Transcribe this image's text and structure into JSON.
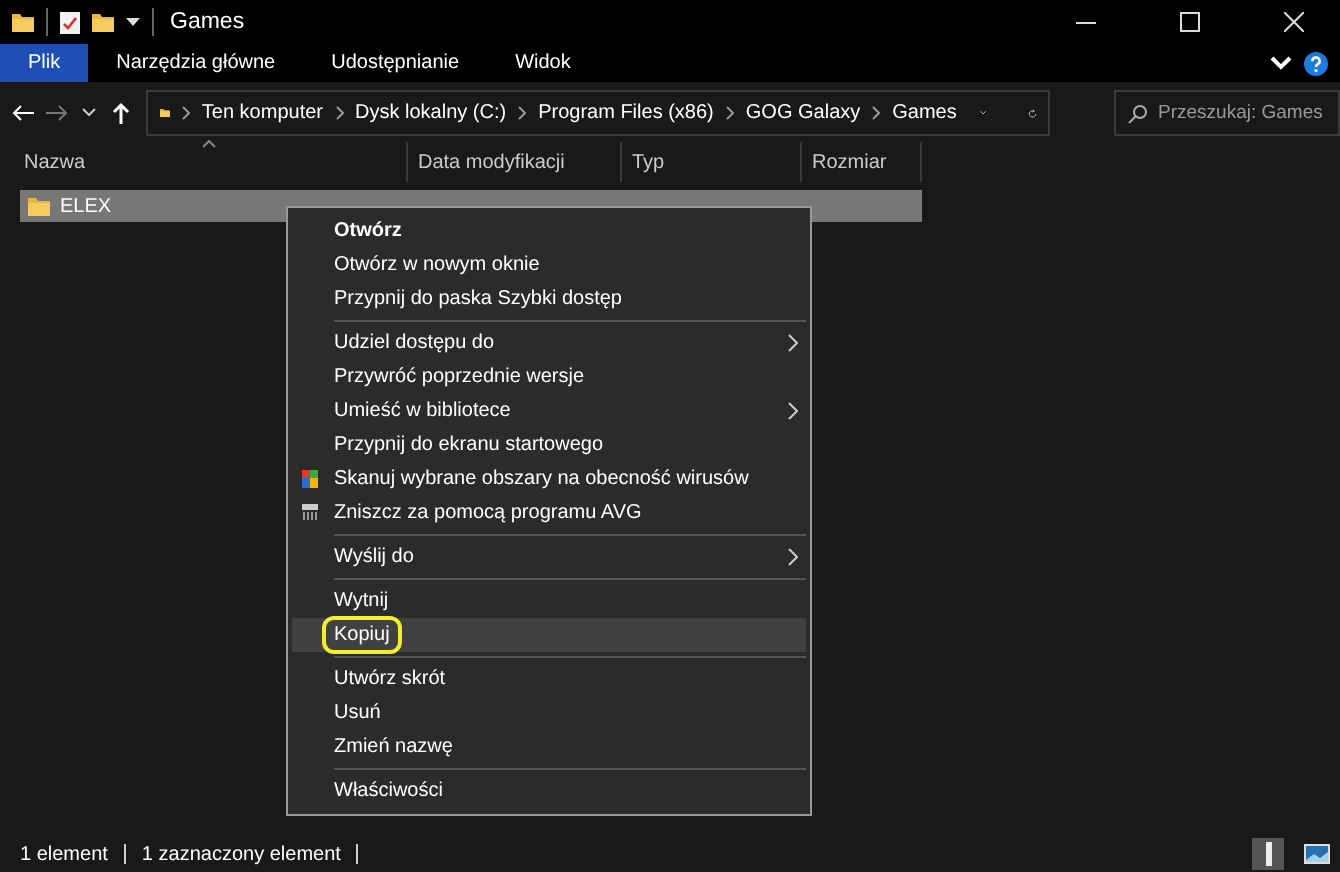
{
  "window": {
    "title": "Games"
  },
  "ribbon_tabs": [
    {
      "label": "Plik",
      "selected": true
    },
    {
      "label": "Narzędzia główne",
      "selected": false
    },
    {
      "label": "Udostępnianie",
      "selected": false
    },
    {
      "label": "Widok",
      "selected": false
    }
  ],
  "breadcrumb": [
    "Ten komputer",
    "Dysk lokalny (C:)",
    "Program Files (x86)",
    "GOG Galaxy",
    "Games"
  ],
  "search": {
    "placeholder": "Przeszukaj: Games"
  },
  "columns": [
    "Nazwa",
    "Data modyfikacji",
    "Typ",
    "Rozmiar"
  ],
  "files": [
    {
      "name": "ELEX",
      "selected": true
    }
  ],
  "context_menu": [
    {
      "kind": "item",
      "label": "Otwórz",
      "bold": true,
      "submenu": false,
      "selected": false,
      "outlined": false
    },
    {
      "kind": "item",
      "label": "Otwórz w nowym oknie",
      "bold": false,
      "submenu": false,
      "selected": false,
      "outlined": false
    },
    {
      "kind": "item",
      "label": "Przypnij do paska Szybki dostęp",
      "bold": false,
      "submenu": false,
      "selected": false,
      "outlined": false
    },
    {
      "kind": "separator"
    },
    {
      "kind": "item",
      "label": "Udziel dostępu do",
      "bold": false,
      "submenu": true,
      "selected": false,
      "outlined": false
    },
    {
      "kind": "item",
      "label": "Przywróć poprzednie wersje",
      "bold": false,
      "submenu": false,
      "selected": false,
      "outlined": false
    },
    {
      "kind": "item",
      "label": "Umieść w bibliotece",
      "bold": false,
      "submenu": true,
      "selected": false,
      "outlined": false
    },
    {
      "kind": "item",
      "label": "Przypnij do ekranu startowego",
      "bold": false,
      "submenu": false,
      "selected": false,
      "outlined": false
    },
    {
      "kind": "scan",
      "label": "Skanuj wybrane obszary na obecność wirusów",
      "bold": false,
      "submenu": false,
      "selected": false,
      "outlined": false
    },
    {
      "kind": "shred",
      "label": "Zniszcz za pomocą programu AVG",
      "bold": false,
      "submenu": false,
      "selected": false,
      "outlined": false
    },
    {
      "kind": "separator"
    },
    {
      "kind": "item",
      "label": "Wyślij do",
      "bold": false,
      "submenu": true,
      "selected": false,
      "outlined": false
    },
    {
      "kind": "separator"
    },
    {
      "kind": "item",
      "label": "Wytnij",
      "bold": false,
      "submenu": false,
      "selected": false,
      "outlined": false
    },
    {
      "kind": "item",
      "label": "Kopiuj",
      "bold": false,
      "submenu": false,
      "selected": true,
      "outlined": true
    },
    {
      "kind": "separator"
    },
    {
      "kind": "item",
      "label": "Utwórz skrót",
      "bold": false,
      "submenu": false,
      "selected": false,
      "outlined": false
    },
    {
      "kind": "item",
      "label": "Usuń",
      "bold": false,
      "submenu": false,
      "selected": false,
      "outlined": false
    },
    {
      "kind": "item",
      "label": "Zmień nazwę",
      "bold": false,
      "submenu": false,
      "selected": false,
      "outlined": false
    },
    {
      "kind": "separator"
    },
    {
      "kind": "item",
      "label": "Właściwości",
      "bold": false,
      "submenu": false,
      "selected": false,
      "outlined": false
    }
  ],
  "status_bar": [
    "1 element",
    "1 zaznaczony element"
  ]
}
